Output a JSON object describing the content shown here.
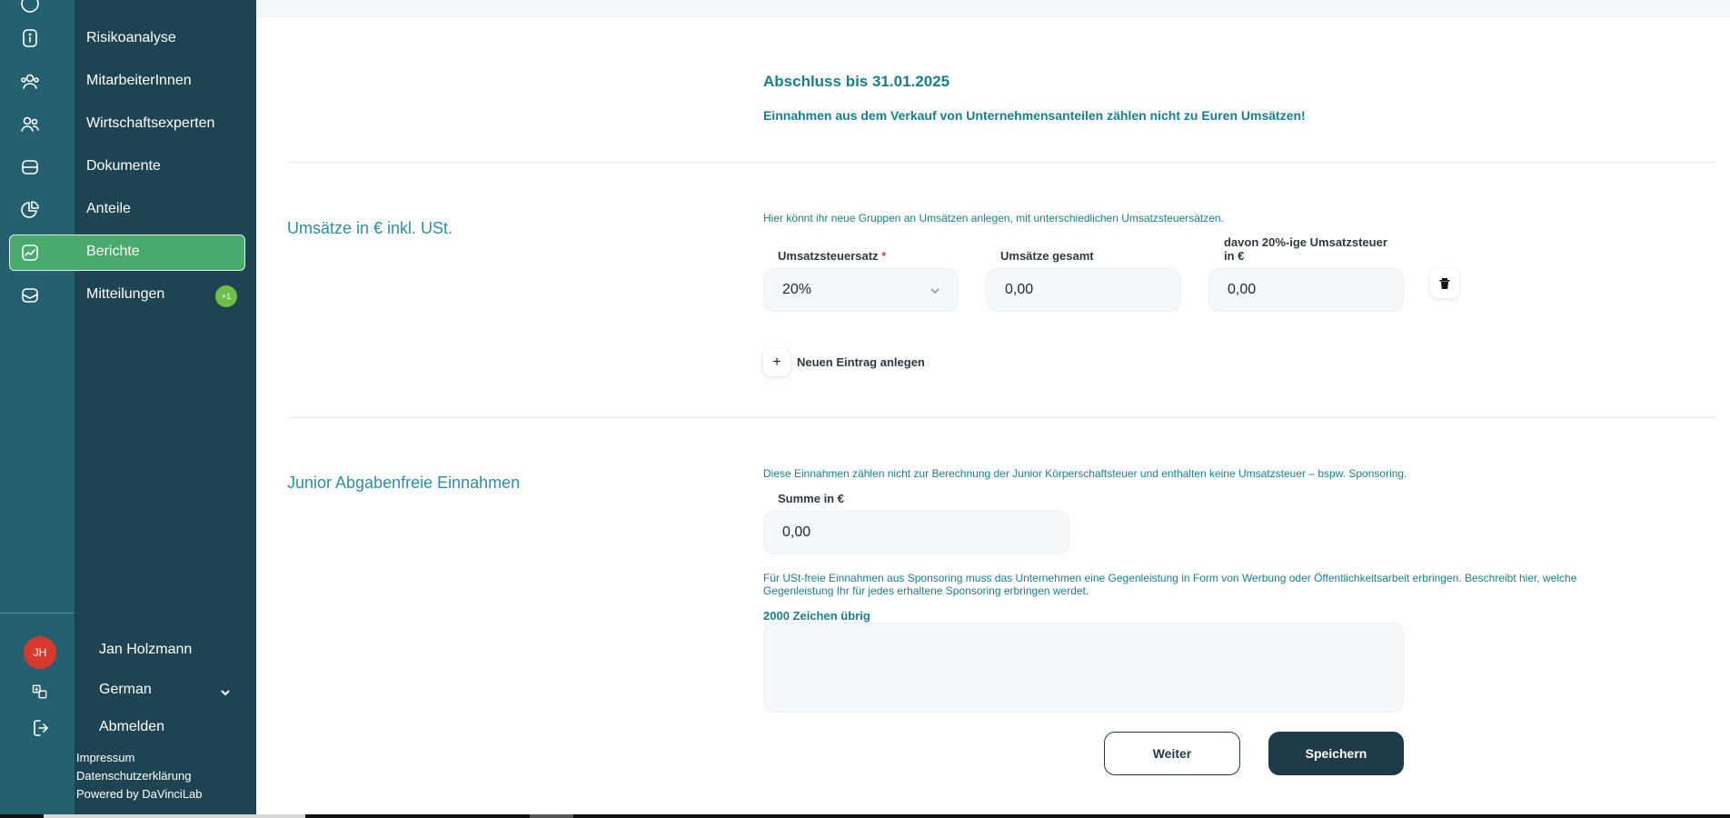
{
  "sidebar": {
    "items": [
      {
        "label": "Risikoanalyse",
        "icon": "clipboard-info-icon"
      },
      {
        "label": "MitarbeiterInnen",
        "icon": "users-icon"
      },
      {
        "label": "Wirtschaftsexperten",
        "icon": "experts-icon"
      },
      {
        "label": "Dokumente",
        "icon": "folder-icon"
      },
      {
        "label": "Anteile",
        "icon": "pie-chart-icon"
      },
      {
        "label": "Berichte",
        "icon": "report-chart-icon",
        "active": true
      },
      {
        "label": "Mitteilungen",
        "icon": "inbox-icon",
        "badge": "+1"
      }
    ],
    "user": {
      "initials": "JH",
      "name": "Jan Holzmann"
    },
    "language": "German",
    "logout": "Abmelden",
    "footer": [
      "Impressum",
      "Datenschutzerklärung",
      "Powered by DaVinciLab"
    ],
    "colors": {
      "rail": "#24606e",
      "panel": "#1f4451",
      "active": "#4aa96c",
      "badge": "#6cc04a",
      "avatar": "#d7392e"
    }
  },
  "header": {
    "title": "Abschluss bis 31.01.2025",
    "subtitle": "Einnahmen aus dem Verkauf von Unternehmensanteilen zählen nicht zu Euren Umsätzen!"
  },
  "umsaetze": {
    "section_label": "Umsätze in € inkl. USt.",
    "hint": "Hier könnt ihr neue Gruppen an Umsätzen anlegen, mit unterschiedlichen Umsatzsteuersätzen.",
    "rate_label": "Umsatzsteuersatz",
    "required_mark": "*",
    "rate_value": "20%",
    "total_label": "Umsätze gesamt",
    "total_value": "0,00",
    "tax_label_1": "davon 20%-ige Umsatzsteuer",
    "tax_label_2": "in €",
    "tax_value": "0,00",
    "add_label": "Neuen Eintrag anlegen",
    "add_symbol": "+"
  },
  "junior": {
    "section_label": "Junior Abgabenfreie Einnahmen",
    "hint": "Diese Einnahmen zählen nicht zur Berechnung der Junior Körperschaftsteuer und enthalten keine Umsatzsteuer – bspw. Sponsoring.",
    "sum_label": "Summe in €",
    "sum_value": "0,00",
    "sponsor_hint_1": "Für USt-freie Einnahmen aus Sponsoring muss das Unternehmen eine Gegenleistung in Form von Werbung oder Öffentlichkeitsarbeit erbringen. Beschreibt hier, welche",
    "sponsor_hint_2": "Gegenleistung Ihr für jedes erhaltene Sponsoring erbringen werdet.",
    "chars_left": "2000 Zeichen übrig"
  },
  "actions": {
    "next": "Weiter",
    "save": "Speichern"
  },
  "accent_color": "#177f8f"
}
